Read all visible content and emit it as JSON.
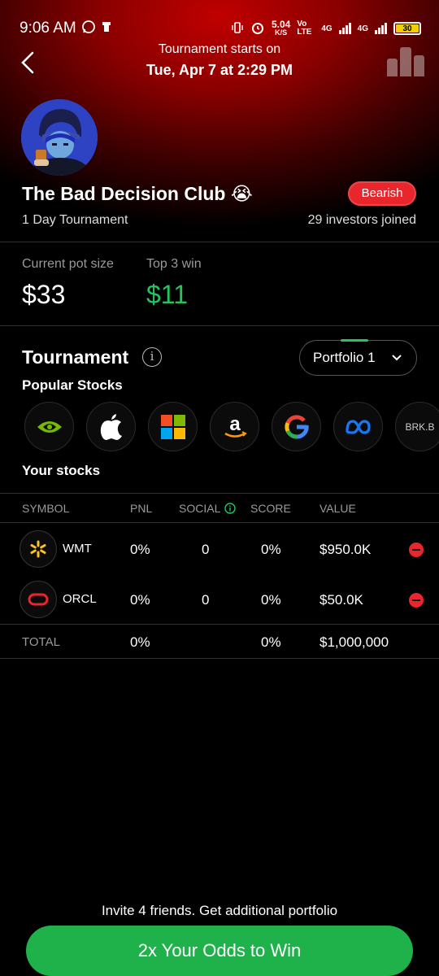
{
  "status": {
    "time": "9:06 AM",
    "speed": "5.04",
    "speed_unit": "K/S",
    "net1": "Vo LTE",
    "net2": "4G",
    "net3": "4G",
    "battery": "30"
  },
  "header": {
    "subtitle": "Tournament starts on",
    "title": "Tue, Apr 7 at 2:29 PM"
  },
  "club": {
    "name": "The Bad Decision Club 😭",
    "badge": "Bearish",
    "duration": "1 Day Tournament",
    "investors": "29 investors joined"
  },
  "pot": {
    "label": "Current pot size",
    "value": "$33",
    "top_label": "Top 3 win",
    "top_value": "$11"
  },
  "tournament": {
    "title": "Tournament",
    "portfolio": "Portfolio 1",
    "popular_title": "Popular Stocks",
    "popular": [
      {
        "icon": "nvidia-icon"
      },
      {
        "icon": "apple-icon"
      },
      {
        "icon": "microsoft-icon"
      },
      {
        "icon": "amazon-icon"
      },
      {
        "icon": "google-icon"
      },
      {
        "icon": "meta-icon"
      },
      {
        "label": "BRK.B"
      }
    ],
    "your_stocks_title": "Your stocks"
  },
  "table": {
    "headers": [
      "SYMBOL",
      "PNL",
      "SOCIAL",
      "SCORE",
      "VALUE"
    ],
    "rows": [
      {
        "symbol": "WMT",
        "pnl": "0%",
        "social": "0",
        "score": "0%",
        "value": "$950.0K"
      },
      {
        "symbol": "ORCL",
        "pnl": "0%",
        "social": "0",
        "score": "0%",
        "value": "$50.0K"
      }
    ],
    "total": {
      "label": "TOTAL",
      "pnl": "0%",
      "score": "0%",
      "value": "$1,000,000"
    }
  },
  "footer": {
    "invite": "Invite 4 friends. Get additional portfolio",
    "cta": "2x Your Odds to Win"
  },
  "colors": {
    "accent_green": "#22c55e",
    "badge_red": "#e8262b",
    "cta_green": "#1fb24a"
  }
}
